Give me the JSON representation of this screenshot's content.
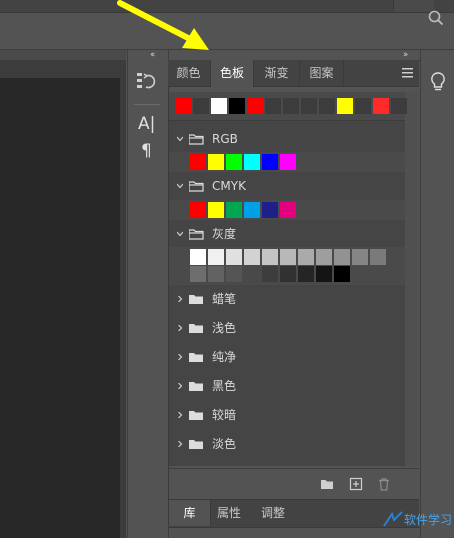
{
  "panel": {
    "tabs": [
      {
        "label": "颜色",
        "active": false
      },
      {
        "label": "色板",
        "active": true
      },
      {
        "label": "渐变",
        "active": false
      },
      {
        "label": "图案",
        "active": false
      }
    ],
    "collapse_left": "‹‹",
    "collapse_right": "››"
  },
  "swatches": {
    "recent": [
      "#ff0000",
      "#3c3c3c",
      "#ffffff",
      "#000000",
      "#ff0000",
      "#3c3c3c",
      "#3c3c3c",
      "#3c3c3c",
      "#3c3c3c",
      "#ffff00",
      "#3c3c3c",
      "#ff2a2a",
      "#3c3c3c"
    ],
    "groups": [
      {
        "name": "RGB",
        "expanded": true,
        "colors": [
          "#ff0000",
          "#ffff00",
          "#00ff00",
          "#00ffff",
          "#0000ff",
          "#ff00ff"
        ]
      },
      {
        "name": "CMYK",
        "expanded": true,
        "colors": [
          "#ff0000",
          "#ffff00",
          "#00a651",
          "#00a0e9",
          "#1d2088",
          "#e4007f"
        ]
      },
      {
        "name": "灰度",
        "expanded": true,
        "colors_row1": [
          "#ffffff",
          "#f0f0f0",
          "#e0e0e0",
          "#d2d2d2",
          "#c4c4c4",
          "#b8b8b8",
          "#aaaaaa",
          "#9e9e9e",
          "#929292",
          "#858585",
          "#7a7a7a"
        ],
        "colors_row2": [
          "#6e6e6e",
          "#626262",
          "#555555",
          "#494949",
          "#3d3d3d",
          "#313131",
          "#252525",
          "#141414",
          "#000000"
        ]
      },
      {
        "name": "蜡笔",
        "expanded": false
      },
      {
        "name": "浅色",
        "expanded": false
      },
      {
        "name": "纯净",
        "expanded": false
      },
      {
        "name": "黑色",
        "expanded": false
      },
      {
        "name": "较暗",
        "expanded": false
      },
      {
        "name": "淡色",
        "expanded": false
      }
    ]
  },
  "bottom_tabs": [
    {
      "label": "库",
      "active": true
    },
    {
      "label": "属性",
      "active": false
    },
    {
      "label": "调整",
      "active": false
    }
  ],
  "icons": {
    "search": "search-icon",
    "history": "history-icon",
    "character": "character-icon",
    "paragraph": "paragraph-icon",
    "learn": "lightbulb-icon",
    "panel_menu": "hamburger-menu-icon",
    "new_group": "folder-icon",
    "new_swatch": "add-swatch-icon",
    "delete": "trash-icon"
  },
  "glyphs": {
    "character": "A|",
    "paragraph": "¶"
  },
  "colors": {
    "annotation_arrow": "#ffff00",
    "active_tab_bg": "#535353",
    "inactive_tab_bg": "#434343"
  },
  "watermark": {
    "text": "软件学习"
  }
}
